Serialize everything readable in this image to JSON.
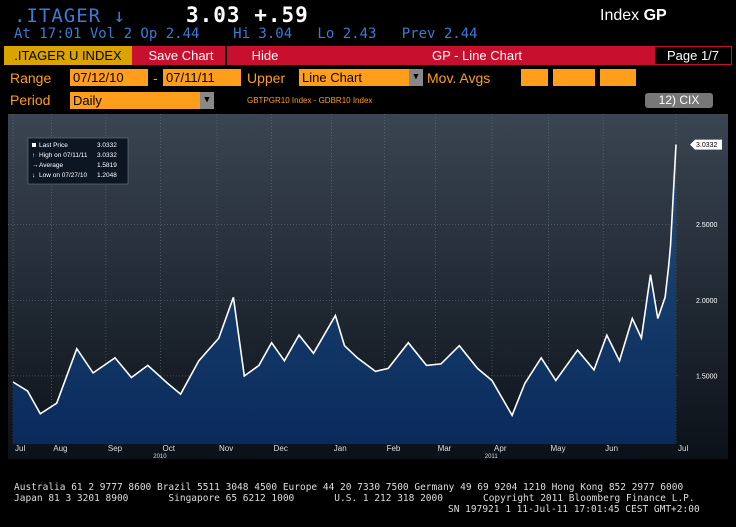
{
  "header": {
    "ticker": ".ITAGER",
    "direction_arrow": "↓",
    "last_price": "3.03",
    "change": "+.59",
    "index_label": "Index",
    "index_code": "GP",
    "quote_line": "At 17:01 Vol 2 Op 2.44    Hi 3.04   Lo 2.43   Prev 2.44"
  },
  "toolbar": {
    "security": ".ITAGER U INDEX",
    "save_chart": "Save Chart",
    "hide": "Hide",
    "title": "GP - Line Chart",
    "page": "Page 1/7"
  },
  "controls": {
    "range_label": "Range",
    "start_date": "07/12/10",
    "range_dash": "-",
    "end_date": "07/11/11",
    "upper_label": "Upper",
    "upper_value": "Line Chart",
    "mov_avgs_label": "Mov. Avgs",
    "period_label": "Period",
    "period_value": "Daily",
    "subtitle": "GBTPGR10 Index - GDBR10 Index",
    "cix_button": "12) CIX"
  },
  "legend": {
    "rows": [
      {
        "label": "Last Price",
        "value": "3.0332"
      },
      {
        "label": "High on 07/11/11",
        "value": "3.0332"
      },
      {
        "label": "Average",
        "value": "1.5819"
      },
      {
        "label": "Low on 07/27/10",
        "value": "1.2048"
      }
    ]
  },
  "last_price_tag": "3.0332",
  "colors": {
    "line": "#ffffff",
    "fill_top": "#1f4e79",
    "fill_bottom": "#0a2a5c",
    "accent_orange": "#ff9e1b",
    "toolbar_red": "#c8102e",
    "ticker_blue": "#3a7bd5"
  },
  "chart_data": {
    "type": "area",
    "x": [
      "2010-07-12",
      "2010-07-20",
      "2010-07-27",
      "2010-08-05",
      "2010-08-16",
      "2010-08-25",
      "2010-09-06",
      "2010-09-15",
      "2010-09-24",
      "2010-10-05",
      "2010-10-12",
      "2010-10-22",
      "2010-11-02",
      "2010-11-10",
      "2010-11-16",
      "2010-11-24",
      "2010-12-01",
      "2010-12-08",
      "2010-12-16",
      "2010-12-24",
      "2011-01-05",
      "2011-01-10",
      "2011-01-17",
      "2011-01-27",
      "2011-02-03",
      "2011-02-14",
      "2011-02-24",
      "2011-03-04",
      "2011-03-14",
      "2011-03-24",
      "2011-04-01",
      "2011-04-12",
      "2011-04-19",
      "2011-04-28",
      "2011-05-06",
      "2011-05-18",
      "2011-05-27",
      "2011-06-03",
      "2011-06-10",
      "2011-06-17",
      "2011-06-22",
      "2011-06-27",
      "2011-07-01",
      "2011-07-05",
      "2011-07-07",
      "2011-07-08",
      "2011-07-11"
    ],
    "series": [
      {
        "values": [
          1.46,
          1.4,
          1.25,
          1.32,
          1.68,
          1.52,
          1.62,
          1.49,
          1.57,
          1.45,
          1.38,
          1.6,
          1.75,
          2.02,
          1.5,
          1.57,
          1.72,
          1.6,
          1.77,
          1.65,
          1.9,
          1.7,
          1.62,
          1.53,
          1.55,
          1.72,
          1.57,
          1.58,
          1.7,
          1.55,
          1.47,
          1.24,
          1.45,
          1.62,
          1.47,
          1.67,
          1.54,
          1.77,
          1.6,
          1.88,
          1.75,
          2.17,
          1.88,
          2.02,
          2.23,
          2.36,
          3.03
        ]
      }
    ],
    "y_ticks": [
      "1.5000",
      "2.0000",
      "2.5000"
    ],
    "ylim": [
      1.05,
      3.1
    ],
    "x_ticks": [
      {
        "label": "Jul",
        "date": "2010-07-12"
      },
      {
        "label": "Aug",
        "date": "2010-08-02"
      },
      {
        "label": "Sep",
        "date": "2010-09-01"
      },
      {
        "label": "Oct",
        "date": "2010-10-01"
      },
      {
        "label": "Nov",
        "date": "2010-11-01"
      },
      {
        "label": "Dec",
        "date": "2010-12-01"
      },
      {
        "label": "Jan",
        "date": "2011-01-03"
      },
      {
        "label": "Feb",
        "date": "2011-02-01"
      },
      {
        "label": "Mar",
        "date": "2011-03-01"
      },
      {
        "label": "Apr",
        "date": "2011-04-01"
      },
      {
        "label": "May",
        "date": "2011-05-02"
      },
      {
        "label": "Jun",
        "date": "2011-06-01"
      },
      {
        "label": "Jul",
        "date": "2011-07-11"
      }
    ],
    "year_labels": [
      {
        "label": "2010",
        "date": "2010-09-27"
      },
      {
        "label": "2011",
        "date": "2011-03-28"
      }
    ],
    "grid": true
  },
  "footer": {
    "line1": "Australia 61 2 9777 8600 Brazil 5511 3048 4500 Europe 44 20 7330 7500 Germany 49 69 9204 1210 Hong Kong 852 2977 6000",
    "line2": "Japan 81 3 3201 8900       Singapore 65 6212 1000       U.S. 1 212 318 2000       Copyright 2011 Bloomberg Finance L.P.",
    "line3": "SN 197921 1 11-Jul-11 17:01:45 CEST GMT+2:00"
  }
}
